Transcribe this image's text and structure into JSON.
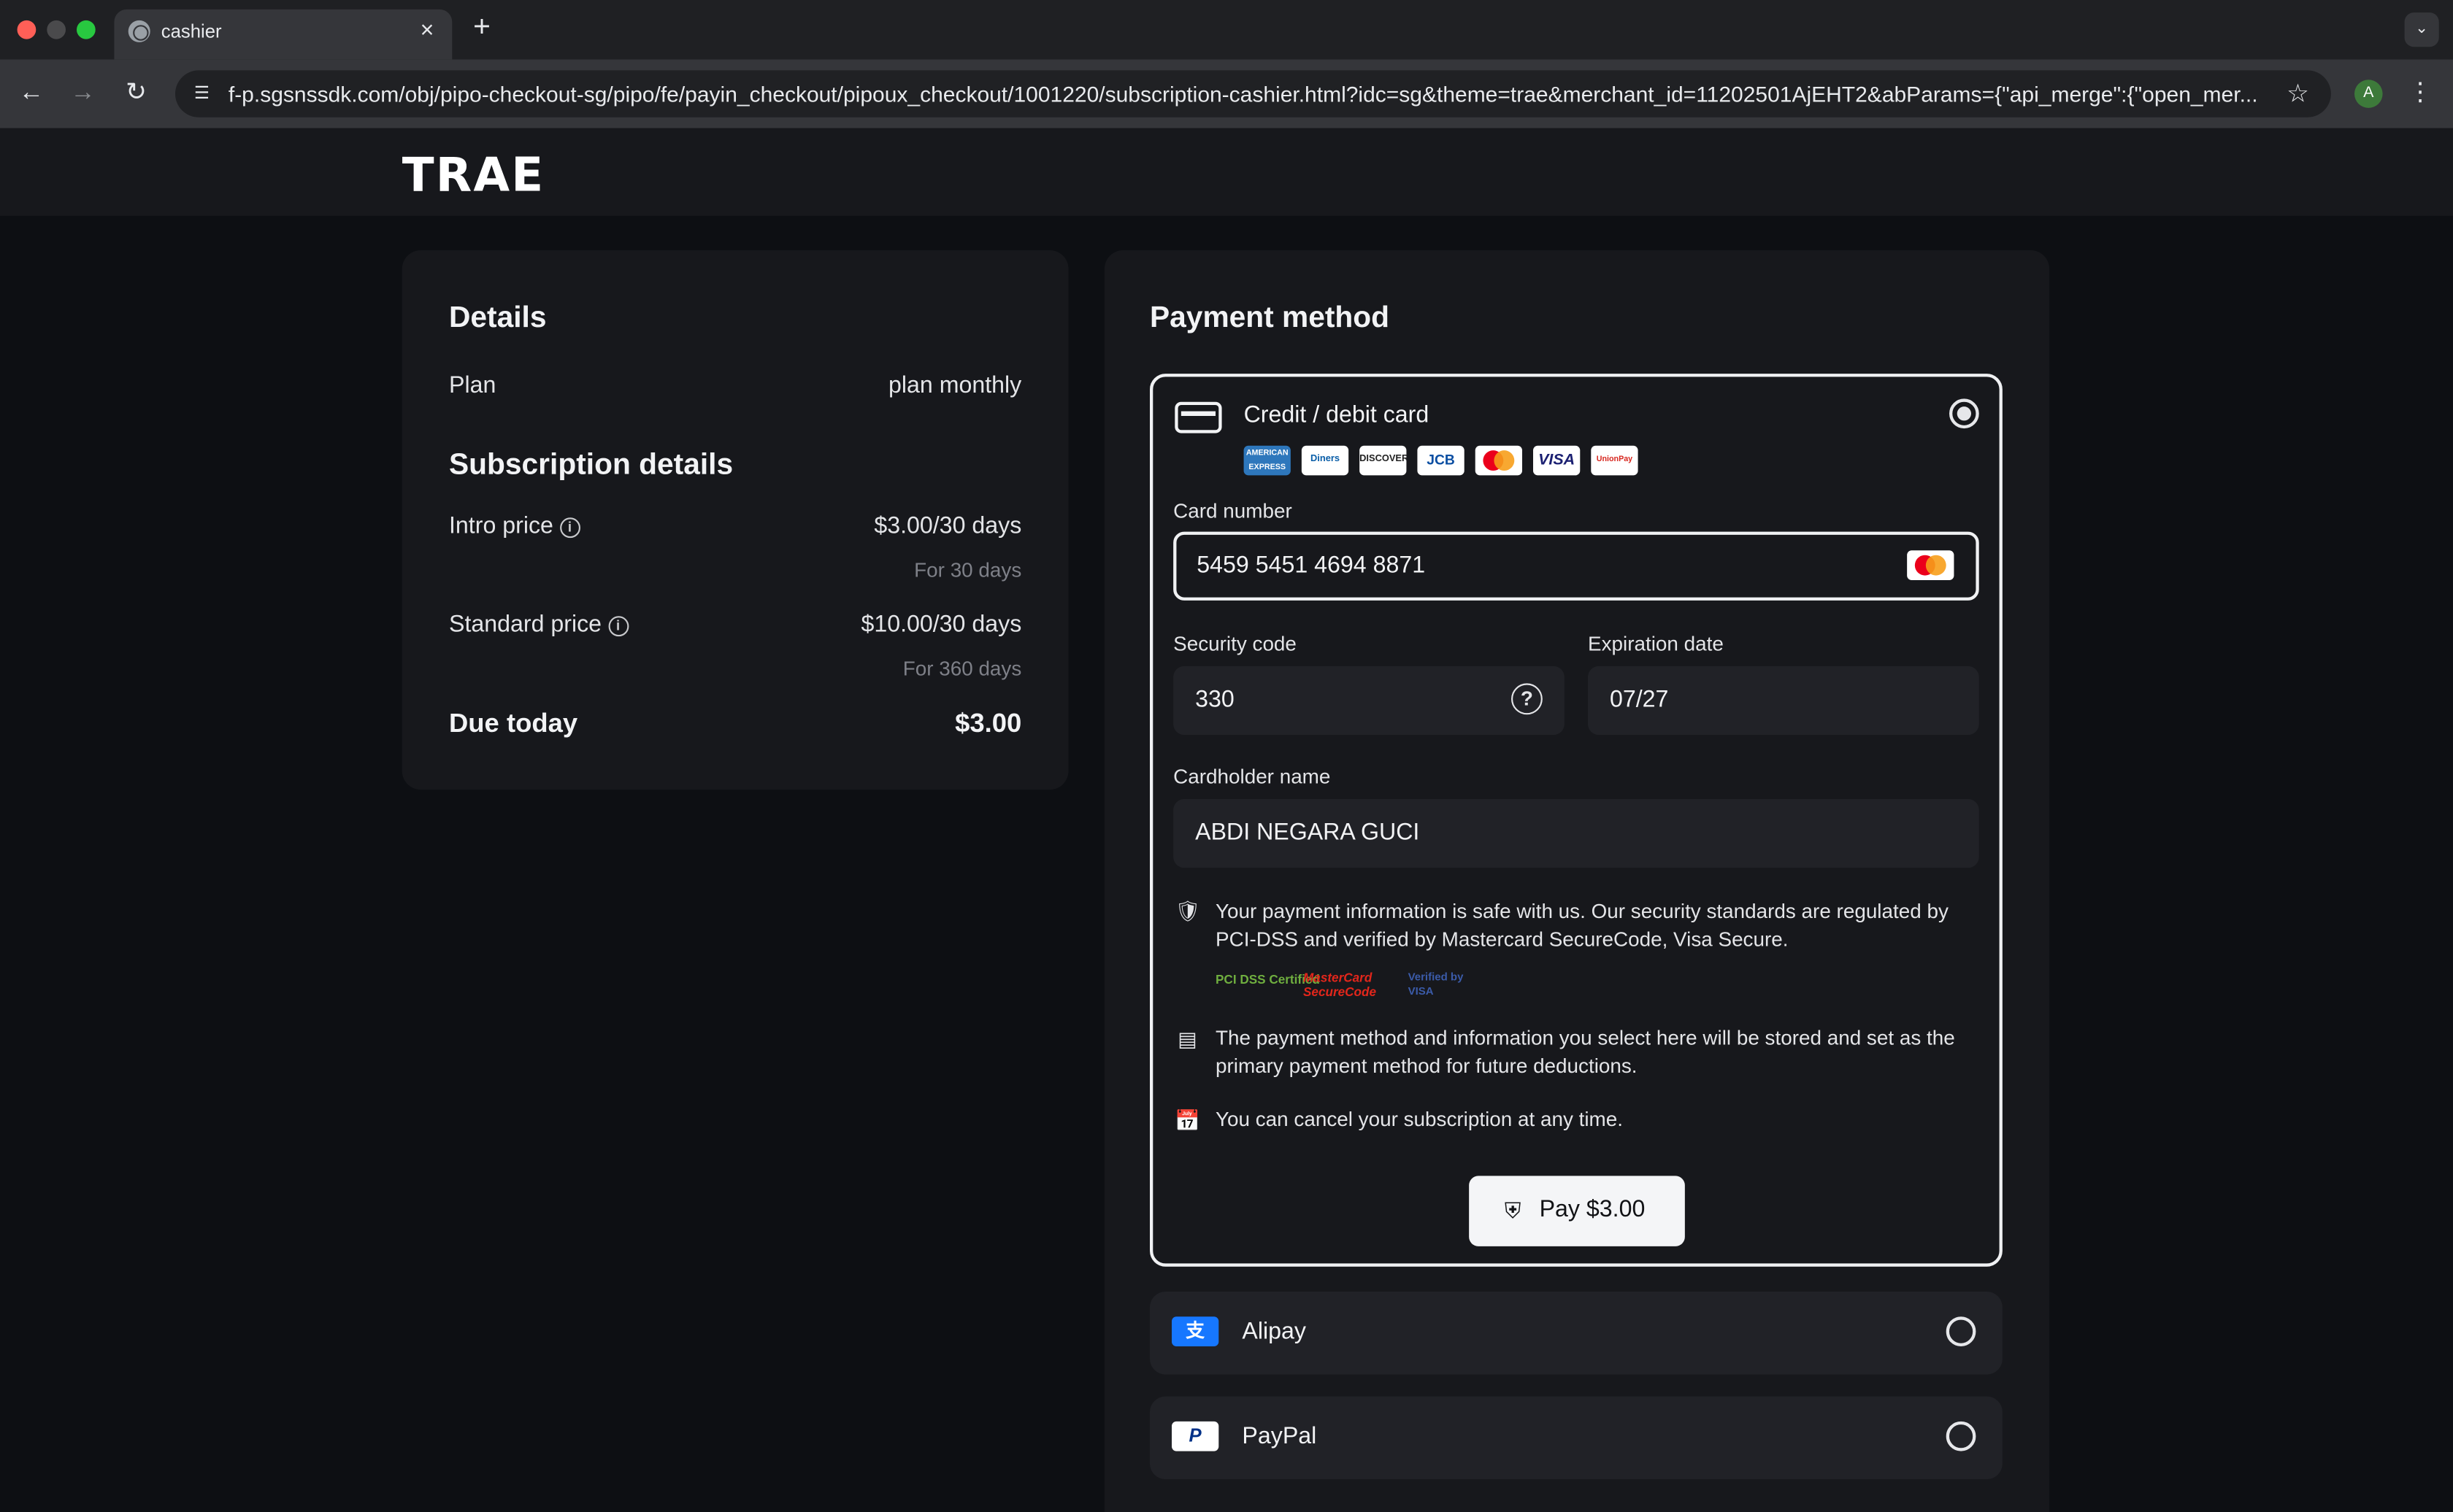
{
  "browser": {
    "tab_title": "cashier",
    "tab_close": "×",
    "new_tab": "+",
    "url": "f-p.sgsnssdk.com/obj/pipo-checkout-sg/pipo/fe/payin_checkout/pipoux_checkout/1001220/subscription-cashier.html?idc=sg&theme=trae&merchant_id=11202501AjEHT2&abParams={\"api_merge\":{\"open_mer...",
    "profile_initial": "A"
  },
  "app": {
    "logo": "TRAE"
  },
  "details": {
    "title": "Details",
    "plan_label": "Plan",
    "plan_value": "plan monthly",
    "subscription_title": "Subscription details",
    "intro_label": "Intro price",
    "intro_value": "$3.00/30 days",
    "intro_sub": "For 30 days",
    "standard_label": "Standard price",
    "standard_value": "$10.00/30 days",
    "standard_sub": "For 360 days",
    "due_label": "Due today",
    "due_value": "$3.00"
  },
  "payment": {
    "title": "Payment method",
    "card": {
      "title": "Credit / debit card",
      "selected": true,
      "brands": [
        "AMERICAN EXPRESS",
        "Diners",
        "DISCOVER",
        "JCB",
        "mastercard",
        "VISA",
        "UnionPay"
      ],
      "card_number_label": "Card number",
      "card_number_value": "5459 5451 4694 8871",
      "security_code_label": "Security code",
      "security_code_value": "330",
      "expiration_label": "Expiration date",
      "expiration_value": "07/27",
      "cardholder_label": "Cardholder name",
      "cardholder_value": "ABDI NEGARA GUCI",
      "security_notice": "Your payment information is safe with us. Our security standards are regulated by PCI-DSS and verified by Mastercard SecureCode, Visa Secure.",
      "certs": [
        "PCI DSS Certified",
        "MasterCard SecureCode",
        "Verified by VISA"
      ],
      "storage_notice": "The payment method and information you select here will be stored and set as the primary payment method for future deductions.",
      "cancel_notice": "You can cancel your subscription at any time.",
      "pay_label": "Pay $3.00"
    },
    "alternatives": [
      {
        "label": "Alipay",
        "selected": false
      },
      {
        "label": "PayPal",
        "selected": false
      }
    ]
  },
  "colors": {
    "page_bg": "#0d0f13",
    "panel_bg": "#17181c",
    "field_bg": "#212227",
    "alipay_blue": "#1677ff",
    "mastercard_red": "#eb001b",
    "mastercard_orange": "#f79e1b"
  }
}
